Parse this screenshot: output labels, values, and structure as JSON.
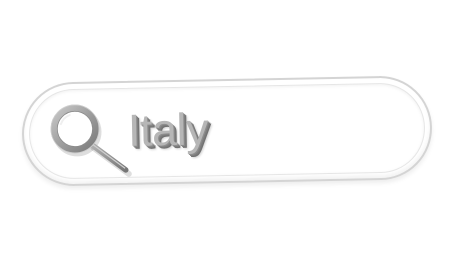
{
  "search": {
    "query": "Italy",
    "icon": "search-icon"
  },
  "colors": {
    "bar_border": "#d4d4d4",
    "text": "#b6b6b6",
    "icon": "#a0a0a0",
    "background": "#ffffff"
  }
}
